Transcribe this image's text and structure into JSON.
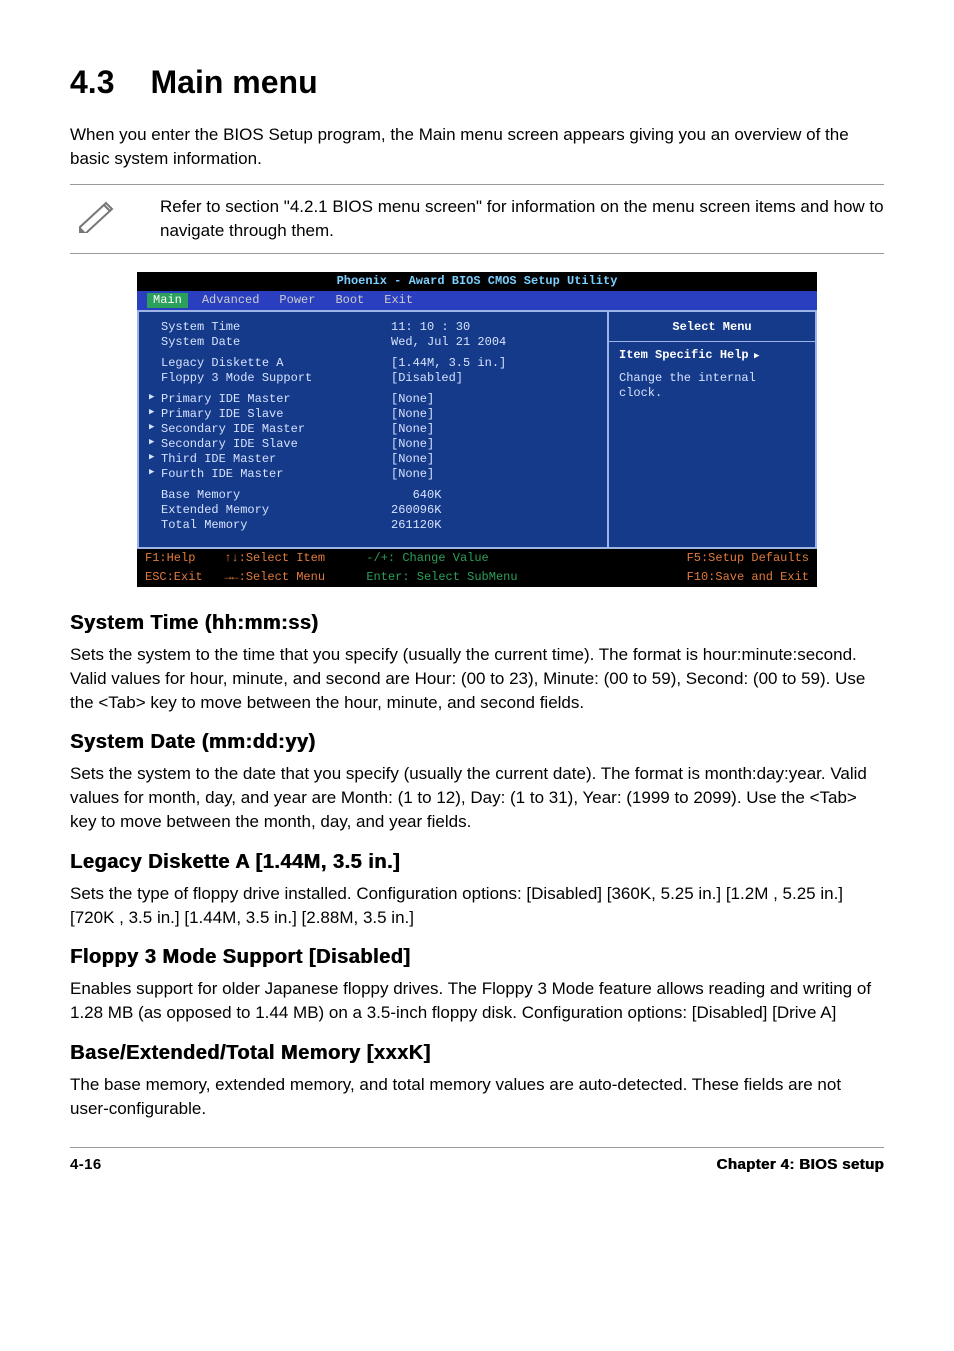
{
  "section": {
    "number": "4.3",
    "title": "Main menu",
    "intro": "When you enter the BIOS Setup program, the Main menu screen appears giving you an overview of the basic system information.",
    "note": "Refer to section \"4.2.1  BIOS menu screen\" for information on the menu screen items and how to navigate through them."
  },
  "bios": {
    "top_title": "Phoenix - Award BIOS CMOS Setup Utility",
    "tabs": [
      "Main",
      "Advanced",
      "Power",
      "Boot",
      "Exit"
    ],
    "active_tab": "Main",
    "rows_plain_top": [
      {
        "label": "System Time",
        "value": "11: 10 : 30"
      },
      {
        "label": "System Date",
        "value": "Wed, Jul 21 2004"
      }
    ],
    "rows_plain_mid": [
      {
        "label": "Legacy Diskette A",
        "value": "[1.44M, 3.5 in.]"
      },
      {
        "label": "Floppy 3 Mode Support",
        "value": "[Disabled]"
      }
    ],
    "rows_sub": [
      {
        "label": "Primary IDE Master",
        "value": "[None]"
      },
      {
        "label": "Primary IDE Slave",
        "value": "[None]"
      },
      {
        "label": "Secondary IDE Master",
        "value": "[None]"
      },
      {
        "label": "Secondary IDE Slave",
        "value": "[None]"
      },
      {
        "label": "Third IDE Master",
        "value": "[None]"
      },
      {
        "label": "Fourth IDE Master",
        "value": "[None]"
      }
    ],
    "rows_plain_bot": [
      {
        "label": "Base Memory",
        "value": "   640K"
      },
      {
        "label": "Extended Memory",
        "value": "260096K"
      },
      {
        "label": "Total Memory",
        "value": "261120K"
      }
    ],
    "right": {
      "header": "Select Menu",
      "help_label": "Item Specific Help",
      "help_text": "Change the internal clock."
    },
    "footer": {
      "l1a": "F1:Help    ↑↓:Select Item",
      "l1b": "-/+: Change Value",
      "l1c": "F5:Setup Defaults",
      "l2a": "ESC:Exit   →←:Select Menu",
      "l2b": "Enter: Select SubMenu",
      "l2c": "F10:Save and Exit"
    }
  },
  "subs": {
    "s1": {
      "h": "System Time (hh:mm:ss)",
      "p": "Sets the system to the time that you specify (usually the current time). The format is hour:minute:second. Valid values for hour, minute, and second are Hour: (00 to 23), Minute: (00 to 59), Second: (00 to 59). Use the <Tab> key to move between the hour, minute, and second fields."
    },
    "s2": {
      "h": "System Date (mm:dd:yy)",
      "p": "Sets the system to the date that you specify (usually the current date). The format is month:day:year. Valid values for month, day, and year are Month: (1 to 12), Day: (1 to 31), Year: (1999 to 2099). Use the <Tab> key to move between the month, day, and year fields."
    },
    "s3": {
      "h": "Legacy Diskette A [1.44M, 3.5 in.]",
      "p": "Sets the type of floppy drive installed. Configuration options: [Disabled] [360K, 5.25 in.] [1.2M , 5.25 in.] [720K , 3.5 in.] [1.44M, 3.5 in.] [2.88M, 3.5 in.]"
    },
    "s4": {
      "h": "Floppy 3 Mode Support [Disabled]",
      "p": "Enables support for older Japanese floppy drives. The Floppy 3 Mode feature allows reading and writing of 1.28 MB (as opposed to 1.44 MB) on a 3.5-inch floppy disk. Configuration options: [Disabled] [Drive A]"
    },
    "s5": {
      "h": "Base/Extended/Total Memory [xxxK]",
      "p": "The base memory, extended memory, and total memory values are auto-detected. These fields are not user-configurable."
    }
  },
  "footer": {
    "page": "4-16",
    "chapter": "Chapter 4: BIOS setup"
  }
}
